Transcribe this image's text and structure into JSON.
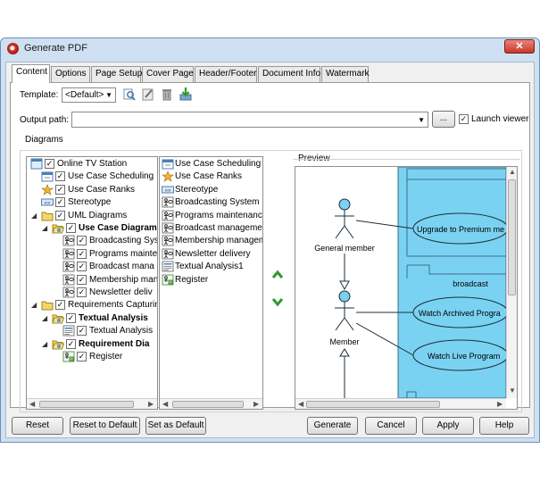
{
  "window": {
    "title": "Generate PDF",
    "close_glyph": "✕"
  },
  "tabs": [
    {
      "label": "Content",
      "active": true
    },
    {
      "label": "Options"
    },
    {
      "label": "Page Setup"
    },
    {
      "label": "Cover Page"
    },
    {
      "label": "Header/Footer"
    },
    {
      "label": "Document Info"
    },
    {
      "label": "Watermark"
    }
  ],
  "template": {
    "label": "Template:",
    "value": "<Default>",
    "icons": [
      "edit-template-icon",
      "new-template-icon",
      "delete-template-icon",
      "import-template-icon"
    ]
  },
  "output": {
    "label": "Output path:",
    "value": "",
    "browse_label": "...",
    "launch_viewer_label": "Launch viewer",
    "launch_viewer_checked": true
  },
  "diagrams": {
    "group_label": "Diagrams",
    "tree": [
      {
        "label": "Online TV Station",
        "level": 0,
        "checked": true,
        "icon": "project-icon"
      },
      {
        "label": "Use Case Scheduling",
        "level": 1,
        "checked": true,
        "icon": "scheduling-icon"
      },
      {
        "label": "Use Case Ranks",
        "level": 1,
        "checked": true,
        "icon": "ranks-icon"
      },
      {
        "label": "Stereotype",
        "level": 1,
        "checked": true,
        "icon": "stereotype-icon"
      },
      {
        "label": "UML Diagrams",
        "level": 1,
        "checked": true,
        "icon": "folder-icon",
        "expanded": true
      },
      {
        "label": "Use Case Diagram",
        "level": 2,
        "checked": true,
        "icon": "folder-open-icon",
        "bold": true,
        "expanded": true
      },
      {
        "label": "Broadcasting Sys",
        "level": 3,
        "checked": true,
        "icon": "use-case-diagram-icon"
      },
      {
        "label": "Programs mainte",
        "level": 3,
        "checked": true,
        "icon": "use-case-diagram-icon"
      },
      {
        "label": "Broadcast mana",
        "level": 3,
        "checked": true,
        "icon": "use-case-diagram-icon"
      },
      {
        "label": "Membership man",
        "level": 3,
        "checked": true,
        "icon": "use-case-diagram-icon"
      },
      {
        "label": "Newsletter deliv",
        "level": 3,
        "checked": true,
        "icon": "use-case-diagram-icon"
      },
      {
        "label": "Requirements Capturing",
        "level": 1,
        "checked": true,
        "icon": "folder-icon",
        "expanded": true
      },
      {
        "label": "Textual Analysis",
        "level": 2,
        "checked": true,
        "icon": "folder-open-icon",
        "bold": true,
        "expanded": true
      },
      {
        "label": "Textual Analysis",
        "level": 3,
        "checked": true,
        "icon": "textual-analysis-icon"
      },
      {
        "label": "Requirement Dia",
        "level": 2,
        "checked": true,
        "icon": "folder-open-icon",
        "bold": true,
        "expanded": true
      },
      {
        "label": "Register",
        "level": 3,
        "checked": true,
        "icon": "requirement-icon"
      }
    ],
    "list": [
      {
        "label": "Use Case Scheduling",
        "icon": "scheduling-icon"
      },
      {
        "label": "Use Case Ranks",
        "icon": "ranks-icon"
      },
      {
        "label": "Stereotype",
        "icon": "stereotype-icon"
      },
      {
        "label": "Broadcasting System Use Ca",
        "icon": "use-case-diagram-icon"
      },
      {
        "label": "Programs maintenance",
        "icon": "use-case-diagram-icon"
      },
      {
        "label": "Broadcast management",
        "icon": "use-case-diagram-icon"
      },
      {
        "label": "Membership management",
        "icon": "use-case-diagram-icon"
      },
      {
        "label": "Newsletter delivery",
        "icon": "use-case-diagram-icon"
      },
      {
        "label": "Textual Analysis1",
        "icon": "textual-analysis-icon"
      },
      {
        "label": "Register",
        "icon": "requirement-icon"
      }
    ],
    "preview_label": "Preview",
    "preview": {
      "actor1": "General member",
      "actor2": "Member",
      "usecase1": "Upgrade to Premium me",
      "package_label": "broadcast",
      "usecase2": "Watch Archived Progra",
      "usecase3": "Watch Live Program",
      "boundary_color": "#7ad2f2"
    }
  },
  "buttons": {
    "reset": "Reset",
    "reset_default": "Reset to Default",
    "set_default": "Set as Default",
    "generate": "Generate",
    "cancel": "Cancel",
    "apply": "Apply",
    "help": "Help"
  },
  "colors": {
    "window_frame": "#cfe0f3",
    "arrow_green": "#3daa3d",
    "close_red": "#c7372a"
  }
}
